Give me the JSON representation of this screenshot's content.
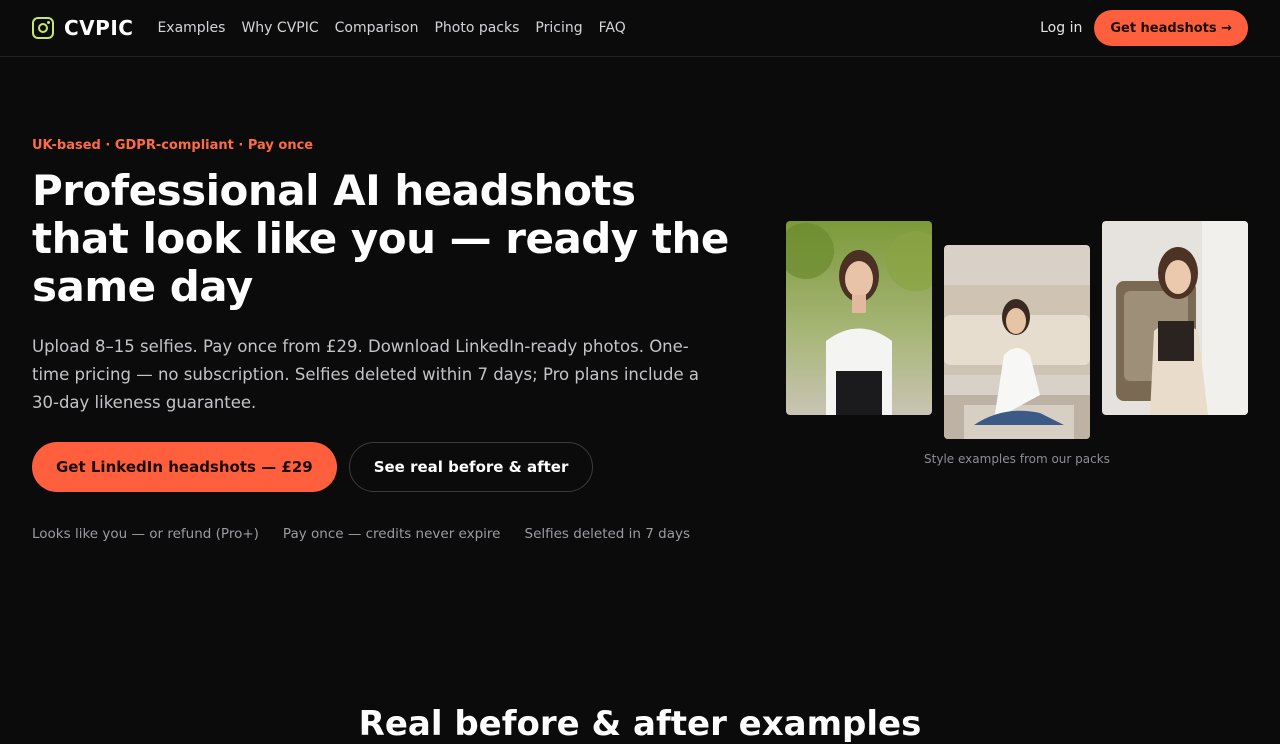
{
  "nav": {
    "brand": "CVPIC",
    "links": [
      "Examples",
      "Why CVPIC",
      "Comparison",
      "Photo packs",
      "Pricing",
      "FAQ"
    ],
    "login": "Log in",
    "cta": "Get headshots →"
  },
  "hero": {
    "eyebrow": "UK-based · GDPR-compliant · Pay once",
    "headline": "Professional AI headshots that look like you — ready the same day",
    "subtitle": "Upload 8–15 selfies. Pay once from £29. Download LinkedIn-ready photos. One-time pricing — no subscription. Selfies deleted within 7 days; Pro plans include a 30-day likeness guarantee.",
    "primary_cta": "Get LinkedIn headshots — £29",
    "secondary_cta": "See real before & after",
    "trust": [
      "Looks like you — or refund (Pro+)",
      "Pay once — credits never expire",
      "Selfies deleted in 7 days"
    ]
  },
  "gallery": {
    "caption": "Style examples from our packs"
  },
  "next_section": {
    "heading": "Real before & after examples"
  }
}
